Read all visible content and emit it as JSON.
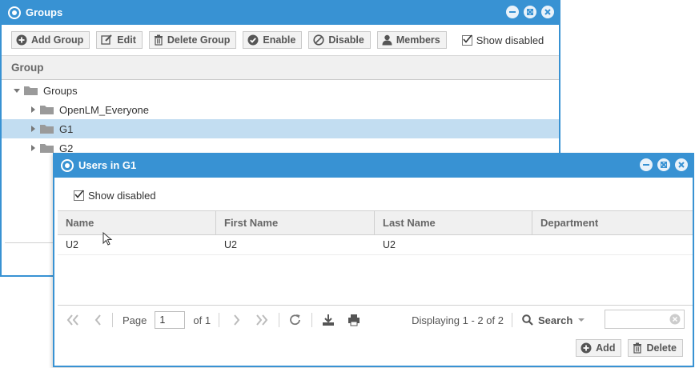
{
  "groups_window": {
    "title": "Groups",
    "toolbar": {
      "add_label": "Add Group",
      "edit_label": "Edit",
      "delete_label": "Delete Group",
      "enable_label": "Enable",
      "disable_label": "Disable",
      "members_label": "Members",
      "show_disabled_label": "Show disabled",
      "show_disabled_checked": true
    },
    "column_header": "Group",
    "tree": [
      {
        "label": "Groups",
        "level": 0,
        "expanded": true
      },
      {
        "label": "OpenLM_Everyone",
        "level": 1,
        "expanded": false
      },
      {
        "label": "G1",
        "level": 1,
        "expanded": false,
        "selected": true
      },
      {
        "label": "G2",
        "level": 1,
        "expanded": false
      }
    ]
  },
  "users_window": {
    "title": "Users in G1",
    "show_disabled_label": "Show disabled",
    "show_disabled_checked": true,
    "columns": [
      "Name",
      "First Name",
      "Last Name",
      "Department"
    ],
    "rows": [
      {
        "name": "U2",
        "first_name": "U2",
        "last_name": "U2",
        "department": ""
      }
    ],
    "pager": {
      "page_label": "Page",
      "page_value": "1",
      "of_label": "of 1",
      "displaying": "Displaying 1 - 2 of 2",
      "search_label": "Search"
    },
    "footer": {
      "add_label": "Add",
      "delete_label": "Delete"
    }
  },
  "colors": {
    "title_bar": "#3892d3",
    "selected_row": "#c2ddf1",
    "header_bg": "#f0f0f0"
  }
}
